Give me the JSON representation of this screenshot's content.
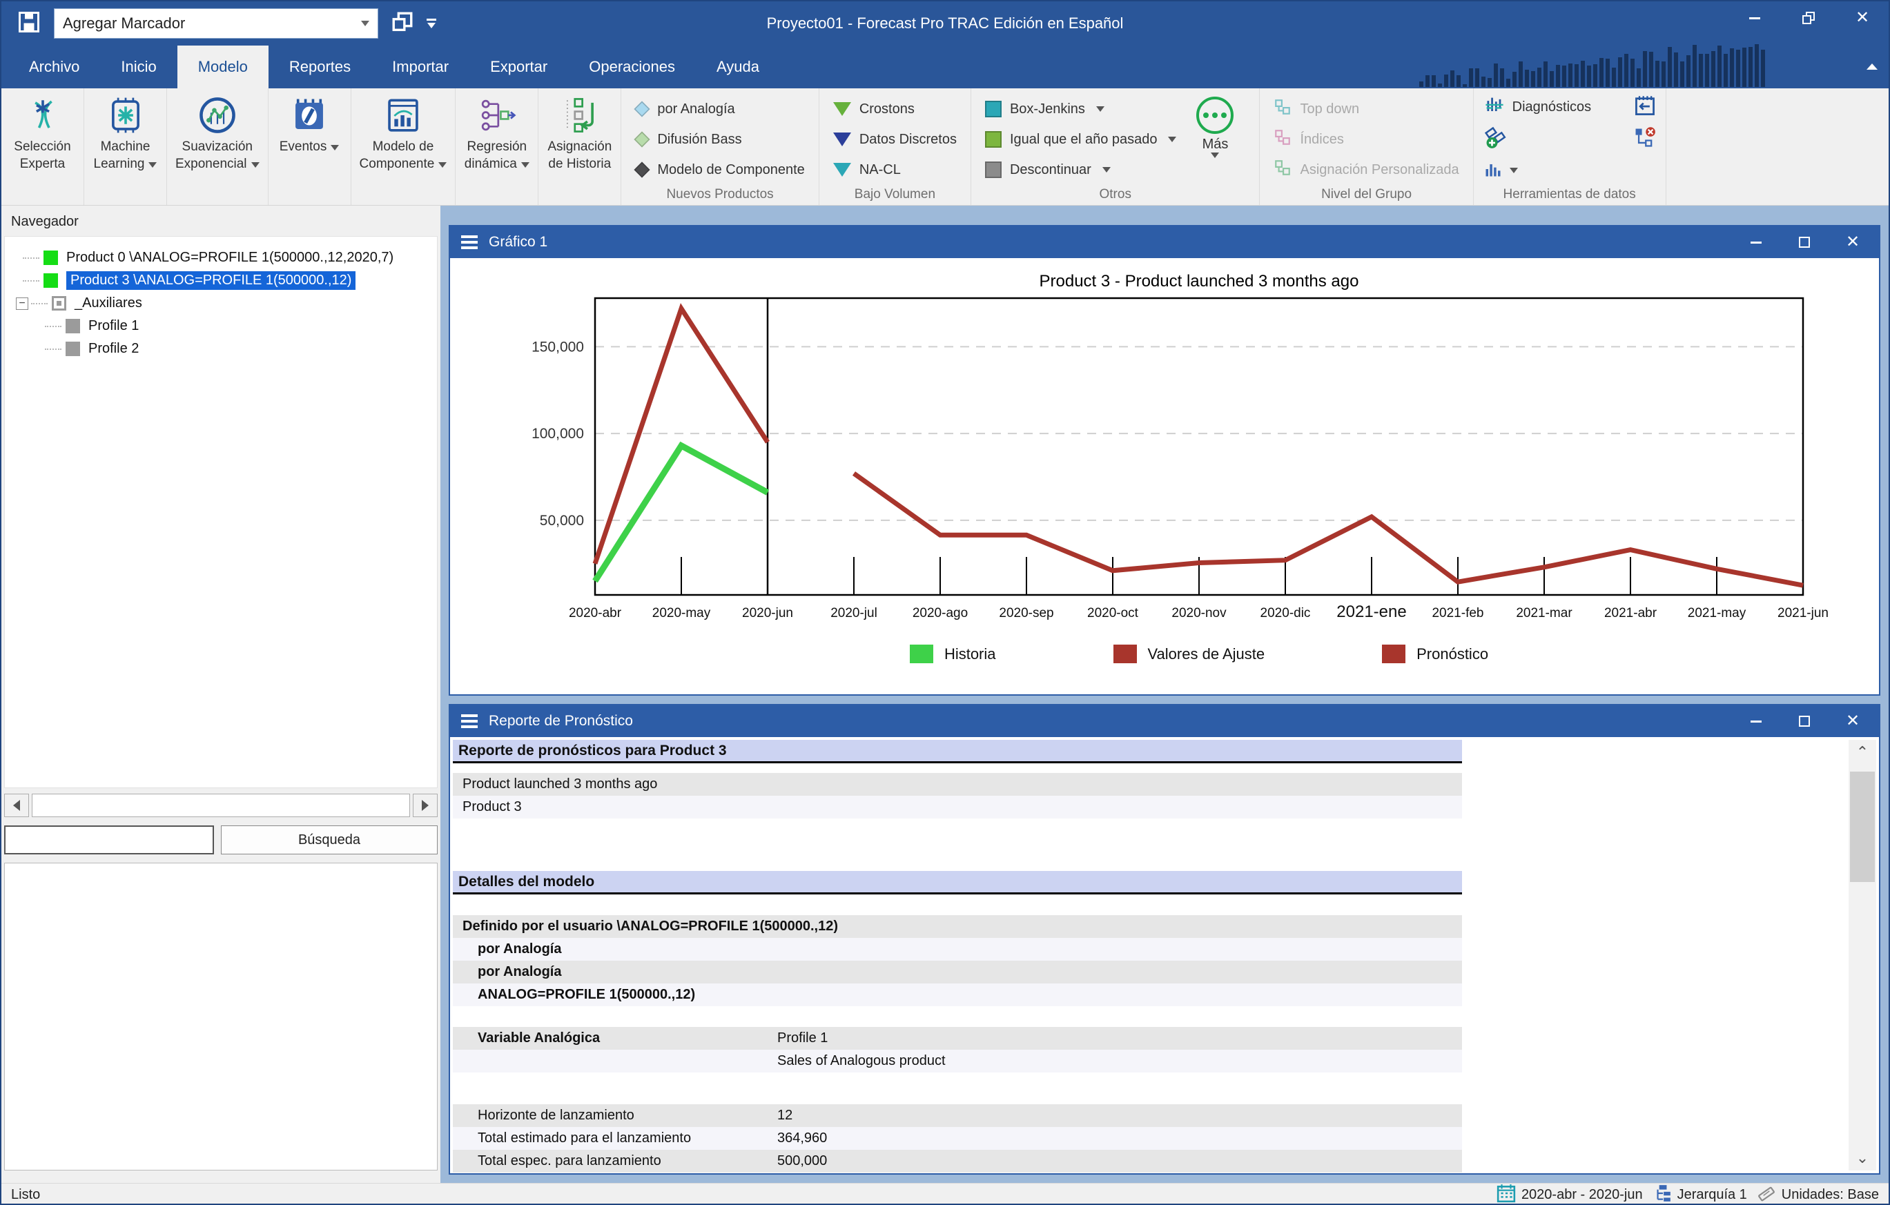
{
  "titlebar": {
    "bookmark_combo_value": "Agregar Marcador",
    "title": "Proyecto01 - Forecast Pro TRAC Edición en Español"
  },
  "tabs": [
    {
      "label": "Archivo",
      "active": false
    },
    {
      "label": "Inicio",
      "active": false
    },
    {
      "label": "Modelo",
      "active": true
    },
    {
      "label": "Reportes",
      "active": false
    },
    {
      "label": "Importar",
      "active": false
    },
    {
      "label": "Exportar",
      "active": false
    },
    {
      "label": "Operaciones",
      "active": false
    },
    {
      "label": "Ayuda",
      "active": false
    }
  ],
  "ribbon": {
    "big_buttons": [
      {
        "id": "seleccion-experta",
        "lines": [
          "Selección",
          "Experta"
        ],
        "dropdown": false
      },
      {
        "id": "machine-learning",
        "lines": [
          "Machine",
          "Learning"
        ],
        "dropdown": true
      },
      {
        "id": "suavizacion-exponencial",
        "lines": [
          "Suavización",
          "Exponencial"
        ],
        "dropdown": true
      },
      {
        "id": "eventos",
        "lines": [
          "Eventos"
        ],
        "dropdown": true
      },
      {
        "id": "modelo-de-componente",
        "lines": [
          "Modelo de",
          "Componente"
        ],
        "dropdown": true
      },
      {
        "id": "regresion-dinamica",
        "lines": [
          "Regresión",
          "dinámica"
        ],
        "dropdown": true
      },
      {
        "id": "asignacion-de-historia",
        "lines": [
          "Asignación",
          "de Historia"
        ],
        "dropdown": false
      }
    ],
    "nuevos_productos": {
      "title": "Nuevos Productos",
      "items": [
        {
          "label": "por Analogía",
          "icon": "diamond",
          "color": "#a9d9ef",
          "caret": false
        },
        {
          "label": "Difusión Bass",
          "icon": "diamond",
          "color": "#b8dcab",
          "caret": false
        },
        {
          "label": "Modelo de Componente",
          "icon": "diamond",
          "color": "#4d4d4f",
          "caret": false
        }
      ]
    },
    "bajo_volumen": {
      "title": "Bajo Volumen",
      "items": [
        {
          "label": "Crostons",
          "icon": "triangle",
          "color": "#66b13c",
          "caret": false
        },
        {
          "label": "Datos Discretos",
          "icon": "triangle",
          "color": "#2c3f9a",
          "caret": false
        },
        {
          "label": "NA-CL",
          "icon": "triangle",
          "color": "#2ba7b6",
          "caret": false
        }
      ]
    },
    "otros": {
      "title": "Otros",
      "more_label": "Más",
      "items": [
        {
          "label": "Box-Jenkins",
          "icon": "square",
          "color": "#2ba7b6",
          "caret": true
        },
        {
          "label": "Igual que el año pasado",
          "icon": "square",
          "color": "#7db63f",
          "caret": true
        },
        {
          "label": "Descontinuar",
          "icon": "square",
          "color": "#8b8b8b",
          "caret": true
        }
      ]
    },
    "nivel_grupo": {
      "title": "Nivel del Grupo",
      "items": [
        {
          "label": "Top down",
          "color": "#7fc4c9"
        },
        {
          "label": "Índices",
          "color": "#d9a0c0"
        },
        {
          "label": "Asignación Personalizada",
          "color": "#8fc7a5"
        }
      ]
    },
    "herramientas": {
      "title": "Herramientas de datos",
      "diagnostics_label": "Diagnósticos"
    }
  },
  "navigator": {
    "title": "Navegador",
    "items": [
      {
        "label": "Product 0 \\ANALOG=PROFILE 1(500000.,12,2020,7)",
        "icon_color": "#15dd15",
        "style": "solid",
        "selected": false,
        "level": 1
      },
      {
        "label": "Product 3 \\ANALOG=PROFILE 1(500000.,12)",
        "icon_color": "#15dd15",
        "style": "solid",
        "selected": true,
        "level": 1
      },
      {
        "label": "_Auxiliares",
        "icon_color": "#9b9b9b",
        "style": "outline",
        "selected": false,
        "level": 0,
        "expander": "minus"
      },
      {
        "label": "Profile 1",
        "icon_color": "#9b9b9b",
        "style": "solid",
        "selected": false,
        "level": 2
      },
      {
        "label": "Profile 2",
        "icon_color": "#9b9b9b",
        "style": "solid",
        "selected": false,
        "level": 2
      }
    ],
    "search_value": "",
    "search_button": "Búsqueda"
  },
  "windows": {
    "chart": {
      "title": "Gráfico 1"
    },
    "report": {
      "title": "Reporte de Pronóstico",
      "rows": [
        {
          "type": "header",
          "text": "Reporte de pronósticos para Product 3"
        },
        {
          "type": "gap",
          "h": 14
        },
        {
          "type": "row",
          "shade": "gray",
          "label": "Product launched 3 months ago"
        },
        {
          "type": "row",
          "shade": "light",
          "label": "Product 3"
        },
        {
          "type": "gap",
          "h": 76
        },
        {
          "type": "header",
          "text": "Detalles del modelo"
        },
        {
          "type": "gap",
          "h": 30
        },
        {
          "type": "row",
          "shade": "gray",
          "bold": true,
          "label": "Definido por el usuario \\ANALOG=PROFILE 1(500000.,12)"
        },
        {
          "type": "row",
          "shade": "light",
          "bold": true,
          "indent": true,
          "label": "por Analogía"
        },
        {
          "type": "row",
          "shade": "gray",
          "bold": true,
          "indent": true,
          "label": "por Analogía"
        },
        {
          "type": "row",
          "shade": "light",
          "bold": true,
          "indent": true,
          "label": "ANALOG=PROFILE 1(500000.,12)"
        },
        {
          "type": "gap",
          "h": 30
        },
        {
          "type": "row",
          "shade": "gray",
          "bold": true,
          "indent": true,
          "label": "Variable Analógica",
          "value": "Profile 1"
        },
        {
          "type": "row",
          "shade": "light",
          "label": "",
          "value": "Sales of Analogous product"
        },
        {
          "type": "gap",
          "h": 46
        },
        {
          "type": "row",
          "shade": "gray",
          "indent": true,
          "label": "Horizonte de lanzamiento",
          "value": "12"
        },
        {
          "type": "row",
          "shade": "light",
          "indent": true,
          "label": "Total estimado para el lanzamiento",
          "value": "364,960"
        },
        {
          "type": "row",
          "shade": "gray",
          "indent": true,
          "label": "Total espec. para lanzamiento",
          "value": "500,000"
        }
      ]
    }
  },
  "chart_data": {
    "type": "line",
    "title": "Product 3 - Product launched 3 months ago",
    "x": [
      "2020-abr",
      "2020-may",
      "2020-jun",
      "2020-jul",
      "2020-ago",
      "2020-sep",
      "2020-oct",
      "2020-nov",
      "2020-dic",
      "2021-ene",
      "2021-feb",
      "2021-mar",
      "2021-abr",
      "2021-may",
      "2021-jun"
    ],
    "series": [
      {
        "name": "Historia",
        "color": "#3ed149",
        "width": 9,
        "values": [
          15000,
          93000,
          66000,
          null,
          null,
          null,
          null,
          null,
          null,
          null,
          null,
          null,
          null,
          null,
          null
        ]
      },
      {
        "name": "Valores de Ajuste",
        "color": "#a8352c",
        "width": 7,
        "values": [
          25000,
          172000,
          95000,
          null,
          null,
          null,
          null,
          null,
          null,
          null,
          null,
          null,
          null,
          null,
          null
        ]
      },
      {
        "name": "Pronóstico",
        "color": "#a8352c",
        "width": 7,
        "values": [
          null,
          null,
          null,
          77000,
          41500,
          41500,
          21000,
          25500,
          27000,
          52000,
          14500,
          23000,
          33000,
          22000,
          12500
        ]
      }
    ],
    "yticks": [
      50000,
      100000,
      150000
    ],
    "ytick_labels": [
      "50,000",
      "100,000",
      "150,000"
    ],
    "ylim": [
      7000,
      178000
    ],
    "history_boundary_index": 2,
    "grid": "horizontal-dashed",
    "legend_position": "bottom",
    "emphasized_x_label": "2021-ene"
  },
  "statusbar": {
    "ready": "Listo",
    "period": "2020-abr - 2020-jun",
    "hierarchy": "Jerarquía 1",
    "units": "Unidades: Base"
  }
}
